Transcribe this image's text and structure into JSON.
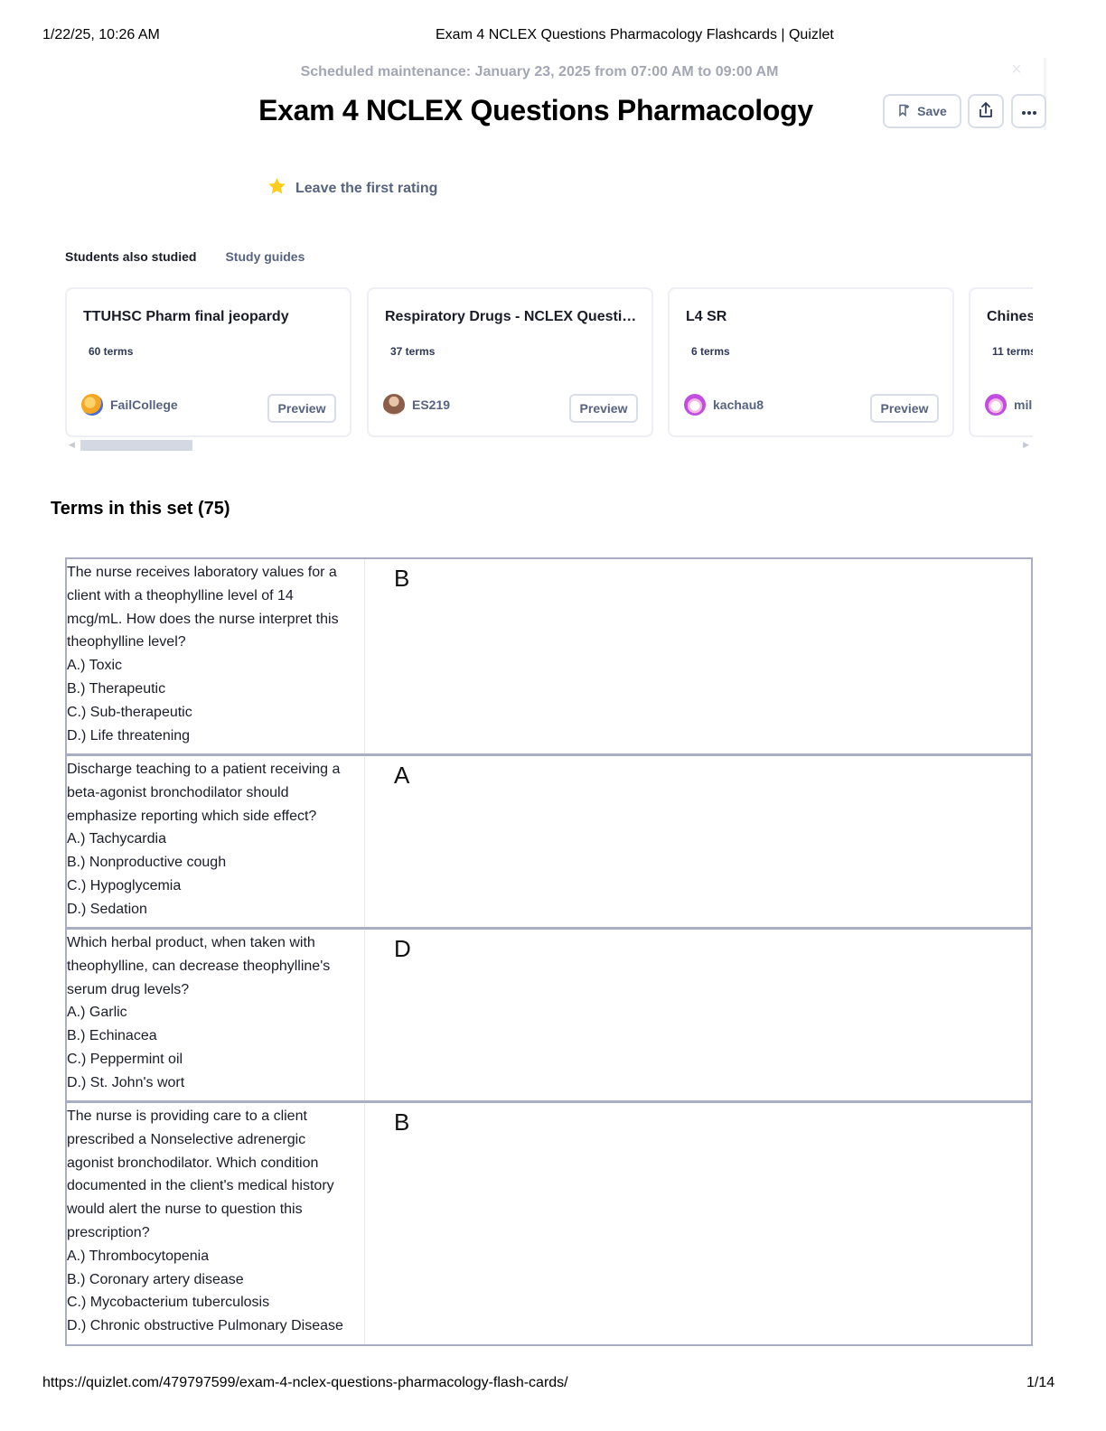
{
  "print_header": {
    "datetime": "1/22/25, 10:26 AM",
    "doc_title": "Exam 4 NCLEX Questions Pharmacology Flashcards | Quizlet"
  },
  "banner": {
    "maintenance": "Scheduled maintenance: January 23, 2025 from 07:00 AM to 09:00 AM"
  },
  "set": {
    "title": "Exam 4 NCLEX Questions Pharmacology",
    "save_label": "Save",
    "rating_label": "Leave the first rating"
  },
  "colors": {
    "star": "#ffcd1f",
    "table_border": "#a9aec2",
    "muted_text": "#586380"
  },
  "related": {
    "tabs": [
      "Students also studied",
      "Study guides"
    ],
    "active_tab": "Students also studied",
    "preview_label": "Preview",
    "cards": [
      {
        "title": "TTUHSC Pharm final jeopardy",
        "terms": "60 terms",
        "author": "FailCollege",
        "avatar": "cartoon-avatar",
        "avatar_color": "#f5a623"
      },
      {
        "title": "Respiratory Drugs - NCLEX Questio...",
        "terms": "37 terms",
        "author": "ES219",
        "avatar": "photo-avatar",
        "avatar_color": "#8b5e4a"
      },
      {
        "title": "L4 SR",
        "terms": "6 terms",
        "author": "kachau8",
        "avatar": "bunny-avatar",
        "avatar_color": "#c04ee0"
      },
      {
        "title": "Chinese",
        "terms": "11 terms",
        "author": "milli",
        "avatar": "bunny-avatar",
        "avatar_color": "#c04ee0"
      }
    ]
  },
  "terms_section": {
    "heading": "Terms in this set (75)",
    "terms": [
      {
        "question_lines": [
          "The nurse receives laboratory values for a",
          "client with a theophylline level of 14",
          "mcg/mL. How does the nurse interpret this",
          "theophylline level?",
          "A.) Toxic",
          "B.) Therapeutic",
          "C.) Sub-therapeutic",
          "D.) Life threatening"
        ],
        "answer": "B"
      },
      {
        "question_lines": [
          "Discharge teaching to a patient receiving a",
          "beta-agonist bronchodilator should",
          "emphasize reporting which side effect?",
          "A.) Tachycardia",
          "B.) Nonproductive cough",
          "C.) Hypoglycemia",
          "D.) Sedation"
        ],
        "answer": "A"
      },
      {
        "question_lines": [
          "Which herbal product, when taken with",
          "theophylline, can decrease theophylline's",
          "serum drug levels?",
          "A.) Garlic",
          "B.) Echinacea",
          "C.) Peppermint oil",
          "D.) St. John's wort"
        ],
        "answer": "D"
      },
      {
        "question_lines": [
          "The nurse is providing care to a client",
          "prescribed a Nonselective adrenergic",
          "agonist bronchodilator. Which condition",
          "documented in the client's medical history",
          "would alert the nurse to question this",
          "prescription?",
          "A.) Thrombocytopenia",
          "B.) Coronary artery disease",
          "C.) Mycobacterium tuberculosis",
          "D.) Chronic obstructive Pulmonary Disease"
        ],
        "answer": "B"
      }
    ]
  },
  "print_footer": {
    "url": "https://quizlet.com/479797599/exam-4-nclex-questions-pharmacology-flash-cards/",
    "page": "1/14"
  }
}
